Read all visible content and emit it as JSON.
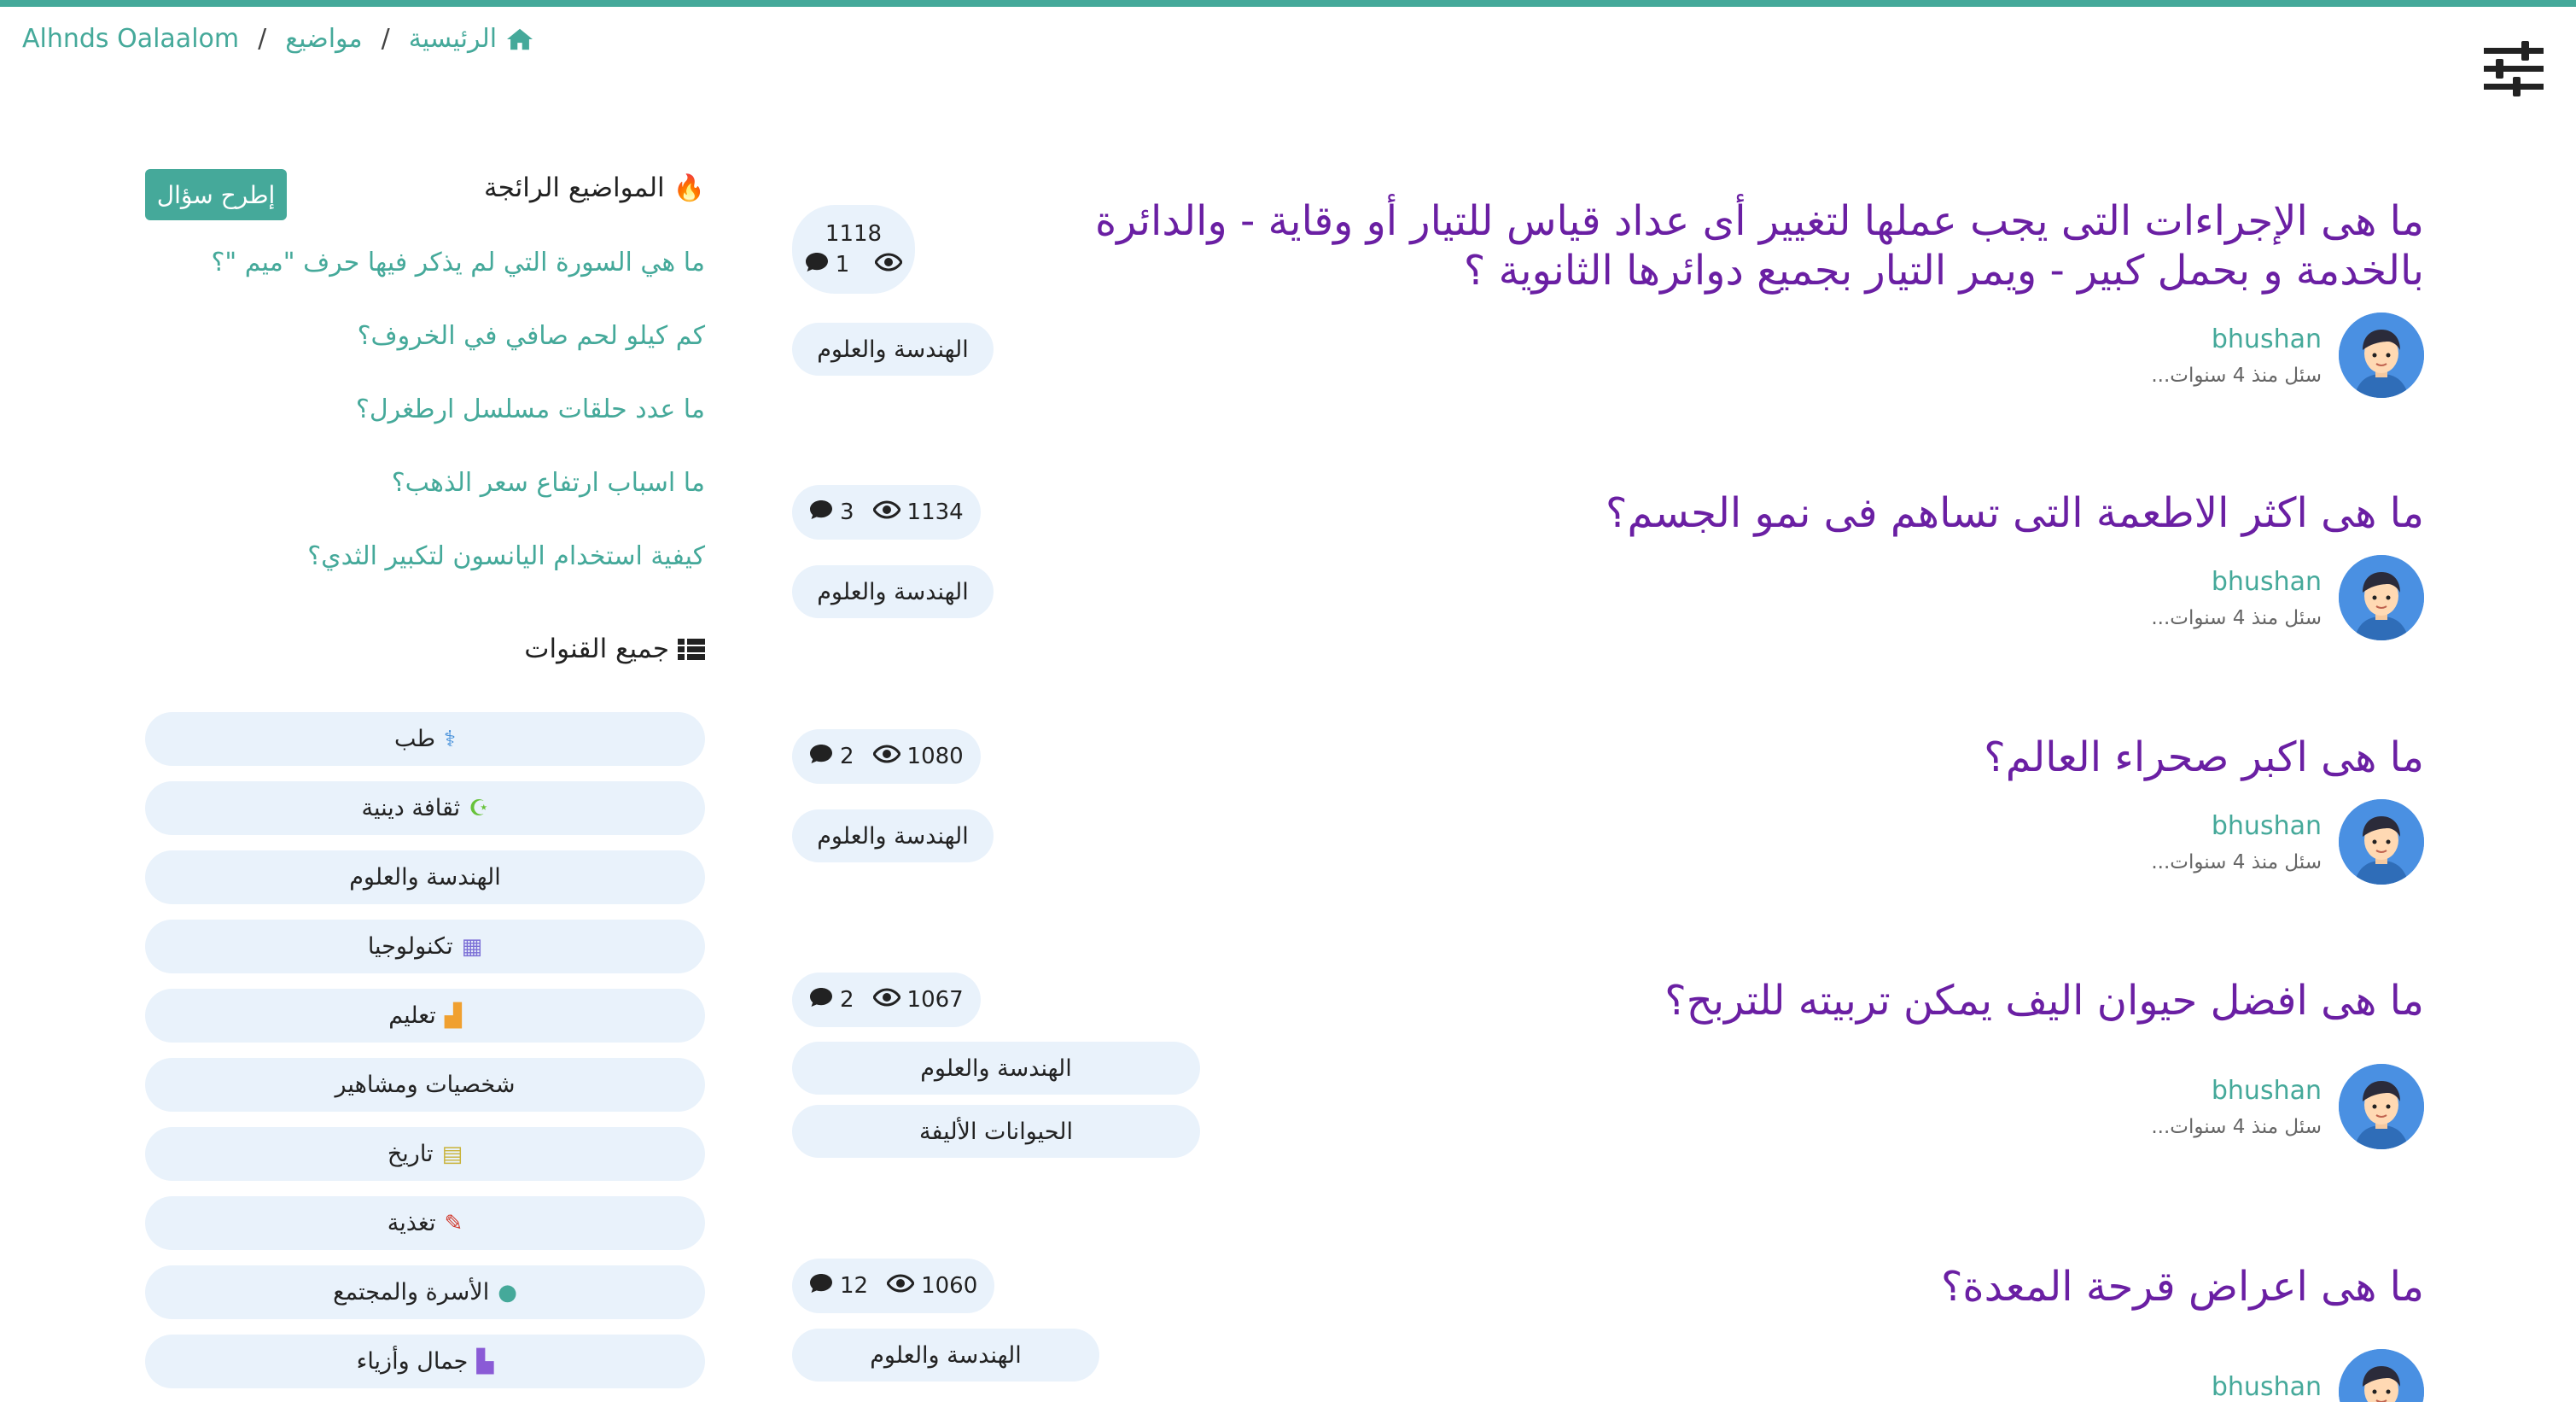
{
  "breadcrumb": {
    "home": "الرئيسية",
    "topics": "مواضيع",
    "current": "Alhnds Oalaalom"
  },
  "icons": {
    "home": "house-icon",
    "settings": "sliders-icon",
    "fire": "fire-icon",
    "list": "list-icon",
    "comment": "comment-icon",
    "views": "eye-icon"
  },
  "colors": {
    "accent": "#45a99a",
    "title": "#6a1fa3",
    "pill": "#e9f2fb",
    "avatar": "#4a90e2"
  },
  "sidebar": {
    "ask_button": "إطرح سؤال",
    "trending_title": "المواضيع الرائجة",
    "trending": [
      "ما هي السورة التي لم يذكر فيها حرف \"ميم \"؟",
      "كم كيلو لحم صافي في الخروف؟",
      "ما عدد حلقات مسلسل ارطغرل؟",
      "ما اسباب ارتفاع سعر الذهب؟",
      "كيفية استخدام اليانسون لتكبير الثدي؟"
    ],
    "channels_title": "جميع القنوات",
    "channels": [
      {
        "label": "طب",
        "icon": "stethoscope-icon",
        "glyph": "⚕",
        "color": "#3b8ad8"
      },
      {
        "label": "ثقافة دينية",
        "icon": "crescent-icon",
        "glyph": "☪",
        "color": "#67c23a"
      },
      {
        "label": "الهندسة والعلوم",
        "icon": "",
        "glyph": "",
        "color": ""
      },
      {
        "label": "تكنولوجيا",
        "icon": "chip-icon",
        "glyph": "▦",
        "color": "#7b6fd6"
      },
      {
        "label": "تعليم",
        "icon": "school-icon",
        "glyph": "▟",
        "color": "#f0a030"
      },
      {
        "label": "شخصيات ومشاهير",
        "icon": "",
        "glyph": "",
        "color": ""
      },
      {
        "label": "تاريخ",
        "icon": "book-icon",
        "glyph": "▤",
        "color": "#c9b33a"
      },
      {
        "label": "تغذية",
        "icon": "carrot-icon",
        "glyph": "✎",
        "color": "#d0382b"
      },
      {
        "label": "الأسرة والمجتمع",
        "icon": "user-icon",
        "glyph": "●",
        "color": "#45a99a"
      },
      {
        "label": "جمال وأزياء",
        "icon": "socks-icon",
        "glyph": "▙",
        "color": "#8a5bd6"
      }
    ]
  },
  "questions": [
    {
      "title": "ما هى الإجراءات التى يجب عملها لتغيير أى عداد قياس للتيار أو وقاية - والدائرة بالخدمة و بحمل كبير - ويمر التيار بجميع دوائرها الثانوية ؟",
      "views": "1118",
      "comments": "1",
      "tags": [
        "الهندسة والعلوم"
      ],
      "author": "bhushan",
      "time": "سئل منذ 4 سنوات..."
    },
    {
      "title": "ما هى اكثر الاطعمة التى تساهم فى نمو الجسم؟",
      "views": "1134",
      "comments": "3",
      "tags": [
        "الهندسة والعلوم"
      ],
      "author": "bhushan",
      "time": "سئل منذ 4 سنوات..."
    },
    {
      "title": "ما هى اكبر صحراء العالم؟",
      "views": "1080",
      "comments": "2",
      "tags": [
        "الهندسة والعلوم"
      ],
      "author": "bhushan",
      "time": "سئل منذ 4 سنوات..."
    },
    {
      "title": "ما هى افضل حيوان اليف يمكن تربيته للتربح؟",
      "views": "1067",
      "comments": "2",
      "tags": [
        "الهندسة والعلوم",
        "الحيوانات الأليفة"
      ],
      "author": "bhushan",
      "time": "سئل منذ 4 سنوات..."
    },
    {
      "title": "ما هى اعراض قرحة المعدة؟",
      "views": "1060",
      "comments": "12",
      "tags": [
        "الهندسة والعلوم"
      ],
      "author": "bhushan",
      "time": ""
    }
  ]
}
